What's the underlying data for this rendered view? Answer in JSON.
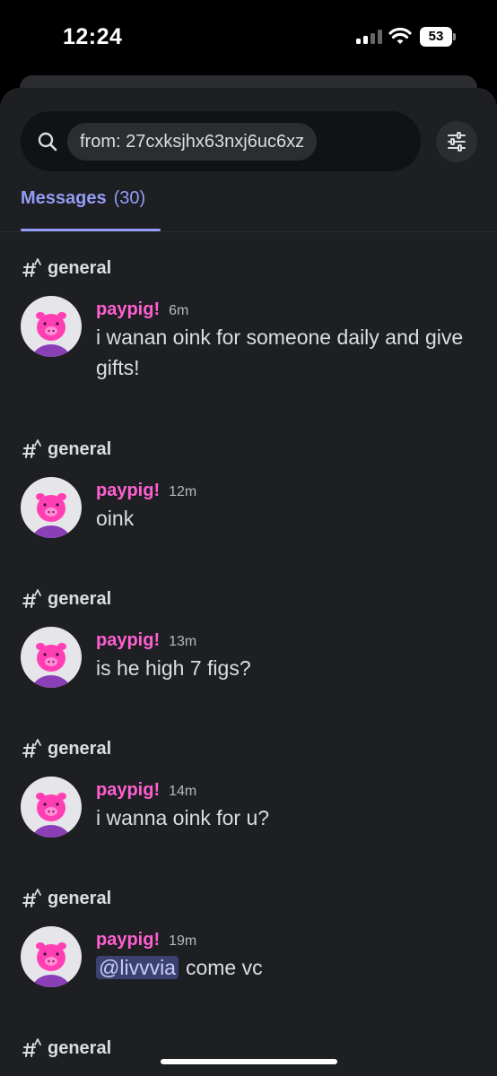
{
  "status_bar": {
    "time": "12:24",
    "battery": "53"
  },
  "search": {
    "query": "from: 27cxksjhx63nxj6uc6xz",
    "icon": "search-icon",
    "filter_icon": "sliders-icon"
  },
  "tabs": [
    {
      "label": "Messages",
      "count": "(30)",
      "active": true
    }
  ],
  "colors": {
    "accent": "#949cf7",
    "username": "#ff5fd1",
    "background": "#1e1f22",
    "mention_bg": "#3c4270"
  },
  "results": [
    {
      "channel": "general",
      "username": "paypig!",
      "time": "6m",
      "mention": "",
      "text": "i wanan oink for someone daily and give gifts!"
    },
    {
      "channel": "general",
      "username": "paypig!",
      "time": "12m",
      "mention": "",
      "text": "oink"
    },
    {
      "channel": "general",
      "username": "paypig!",
      "time": "13m",
      "mention": "",
      "text": "is he high 7 figs?"
    },
    {
      "channel": "general",
      "username": "paypig!",
      "time": "14m",
      "mention": "",
      "text": "i wanna oink for u?"
    },
    {
      "channel": "general",
      "username": "paypig!",
      "time": "19m",
      "mention": "@livvvia",
      "text": "come vc"
    },
    {
      "channel": "general"
    }
  ]
}
